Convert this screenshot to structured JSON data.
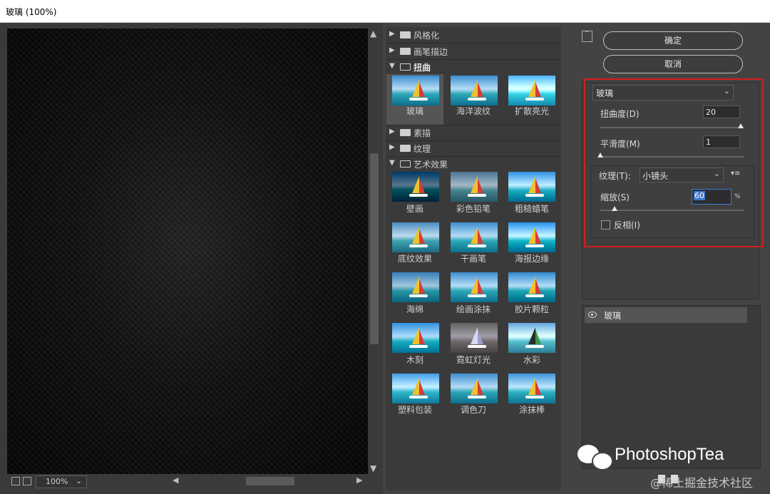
{
  "window": {
    "title": "玻璃 (100%)"
  },
  "preview": {
    "zoom": "100%"
  },
  "gallery": {
    "folders": [
      {
        "label": "风格化",
        "expanded": false
      },
      {
        "label": "画笔描边",
        "expanded": false
      },
      {
        "label": "扭曲",
        "expanded": true,
        "filters": [
          "玻璃",
          "海洋波纹",
          "扩散亮光"
        ],
        "selected": "玻璃"
      },
      {
        "label": "素描",
        "expanded": false
      },
      {
        "label": "纹理",
        "expanded": false
      },
      {
        "label": "艺术效果",
        "expanded": true,
        "filters": [
          "壁画",
          "彩色铅笔",
          "粗糙蜡笔",
          "底纹效果",
          "干画笔",
          "海报边缘",
          "海绵",
          "绘画涂抹",
          "胶片颗粒",
          "木刻",
          "霓虹灯光",
          "水彩",
          "塑料包装",
          "调色刀",
          "涂抹棒"
        ]
      }
    ]
  },
  "actions": {
    "ok": "确定",
    "cancel": "取消"
  },
  "settings": {
    "filter": "玻璃",
    "distortion": {
      "label": "扭曲度(D)",
      "value": "20",
      "slider": 1.0
    },
    "smoothness": {
      "label": "平滑度(M)",
      "value": "1",
      "slider": 0.0
    },
    "texture": {
      "label": "纹理(T):",
      "value": "小镜头"
    },
    "scaling": {
      "label": "缩放(S)",
      "value": "60",
      "unit": "%",
      "slider": 0.1
    },
    "invert": {
      "label": "反相(I)",
      "checked": false
    }
  },
  "layers": [
    {
      "name": "玻璃"
    }
  ],
  "watermark": {
    "brand": "PhotoshopTea",
    "sub": "@稀土掘金技术社区"
  }
}
